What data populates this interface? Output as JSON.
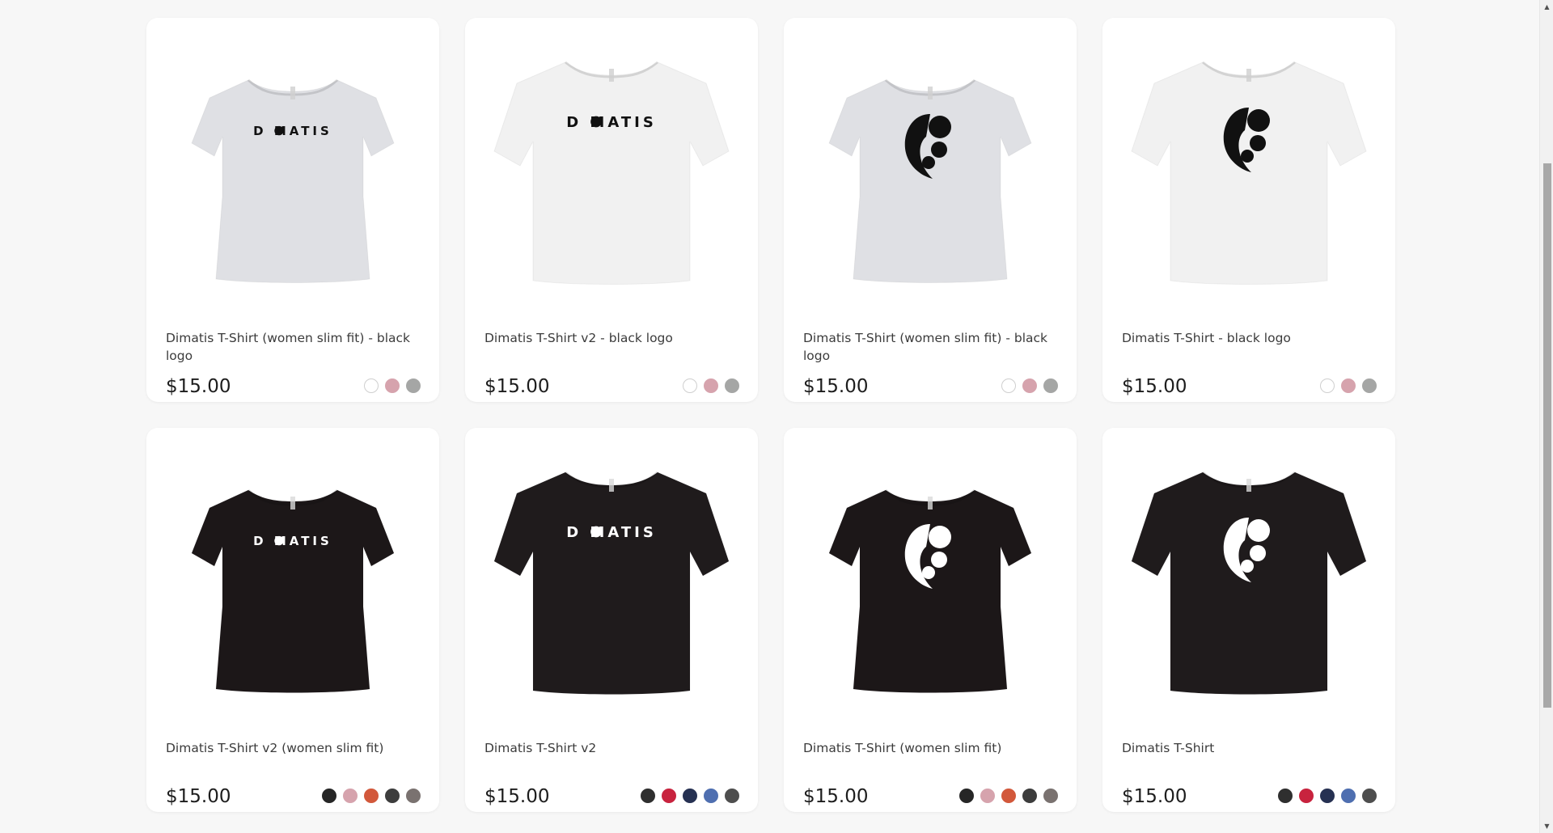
{
  "products": [
    {
      "title": "Dimatis T-Shirt (women slim fit) - black logo",
      "price": "$15.00",
      "shirt_color": "#dfe0e4",
      "fit": "slim",
      "logo": "wordmark",
      "logo_color": "#111111",
      "swatches": [
        "#ffffff",
        "#d6a3ad",
        "#a5a6a5"
      ]
    },
    {
      "title": "Dimatis T-Shirt v2 - black logo",
      "price": "$15.00",
      "shirt_color": "#f1f1f1",
      "fit": "regular",
      "logo": "wordmark",
      "logo_color": "#111111",
      "swatches": [
        "#ffffff",
        "#d6a3ad",
        "#a5a6a5"
      ]
    },
    {
      "title": "Dimatis T-Shirt (women slim fit) - black logo",
      "price": "$15.00",
      "shirt_color": "#dfe0e4",
      "fit": "slim",
      "logo": "mark",
      "logo_color": "#111111",
      "swatches": [
        "#ffffff",
        "#d6a3ad",
        "#a5a6a5"
      ]
    },
    {
      "title": "Dimatis T-Shirt - black logo",
      "price": "$15.00",
      "shirt_color": "#f1f1f1",
      "fit": "regular",
      "logo": "mark",
      "logo_color": "#111111",
      "swatches": [
        "#ffffff",
        "#d6a3ad",
        "#a5a6a5"
      ]
    },
    {
      "title": "Dimatis T-Shirt v2 (women slim fit)",
      "price": "$15.00",
      "shirt_color": "#1c1718",
      "fit": "slim",
      "logo": "wordmark",
      "logo_color": "#ffffff",
      "swatches": [
        "#262626",
        "#d6a3ad",
        "#d2583b",
        "#3d3d3d",
        "#7a7270"
      ]
    },
    {
      "title": "Dimatis T-Shirt v2",
      "price": "$15.00",
      "shirt_color": "#1f1b1c",
      "fit": "regular",
      "logo": "wordmark",
      "logo_color": "#ffffff",
      "swatches": [
        "#2f2f2f",
        "#c8233e",
        "#263152",
        "#4f6fb0",
        "#4e4e4e"
      ]
    },
    {
      "title": "Dimatis T-Shirt (women slim fit)",
      "price": "$15.00",
      "shirt_color": "#1c1718",
      "fit": "slim",
      "logo": "mark",
      "logo_color": "#ffffff",
      "swatches": [
        "#262626",
        "#d6a3ad",
        "#d2583b",
        "#3d3d3d",
        "#7a7270"
      ]
    },
    {
      "title": "Dimatis T-Shirt",
      "price": "$15.00",
      "shirt_color": "#1f1b1c",
      "fit": "regular",
      "logo": "mark",
      "logo_color": "#ffffff",
      "swatches": [
        "#2f2f2f",
        "#c8233e",
        "#263152",
        "#4f6fb0",
        "#4e4e4e"
      ]
    }
  ],
  "brand": {
    "wordmark_text": "D MATIS"
  },
  "scrollbar": {
    "up_icon": "triangle-up-icon",
    "down_icon": "triangle-down-icon"
  }
}
